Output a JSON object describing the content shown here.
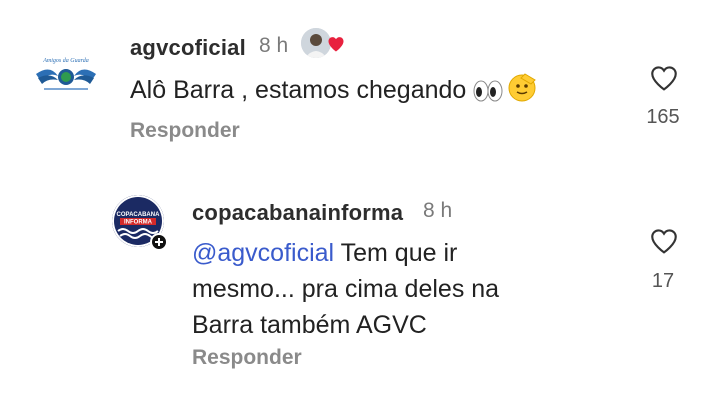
{
  "comments": [
    {
      "username": "agvcoficial",
      "time": "8 h",
      "text": "Alô Barra , estamos chegando ",
      "emoji": [
        "eyes-emoji",
        "saluting-face-emoji"
      ],
      "reply_label": "Responder",
      "likes": "165",
      "avatar_logo_text": "Amigos da Guarda"
    },
    {
      "username": "copacabanainforma",
      "time": "8 h",
      "mention": "@agvcoficial",
      "text_lines": [
        "Tem que ir",
        "mesmo... pra cima deles na",
        "Barra também AGVC"
      ],
      "reply_label": "Responder",
      "likes": "17",
      "avatar_logo_text": [
        "COPACABANA",
        "INFORMA"
      ]
    }
  ],
  "colors": {
    "accent_heart": "#e8213e",
    "mention": "#3a5bcc",
    "copacabana_navy": "#1b2a63",
    "copacabana_red": "#d42a2a"
  }
}
